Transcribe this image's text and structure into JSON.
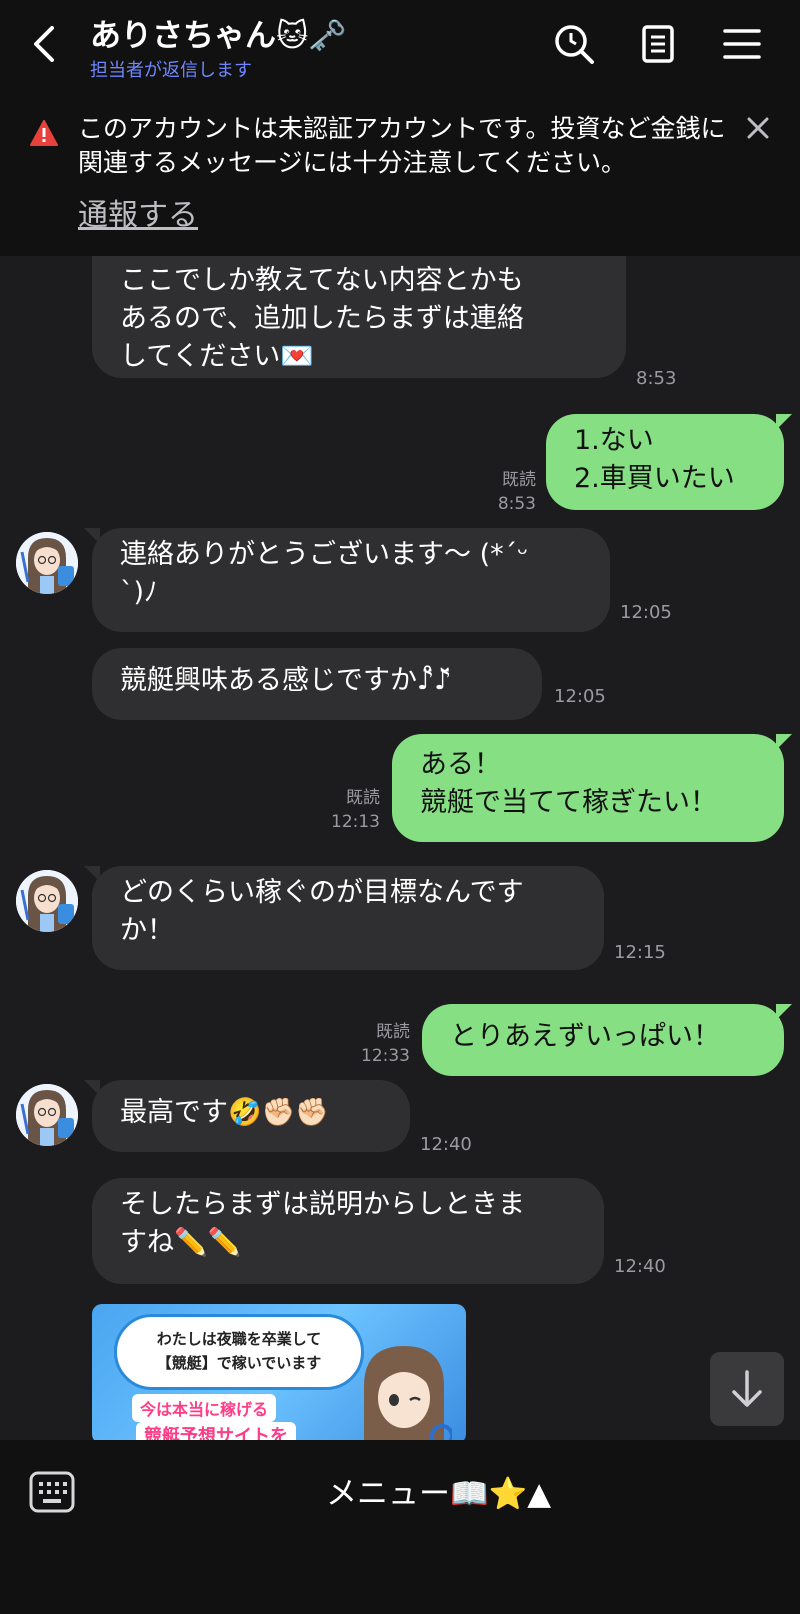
{
  "header": {
    "title": "ありさちゃん🐱🗝️",
    "subtitle": "担当者が返信します"
  },
  "warning": {
    "text": "このアカウントは未認証アカウントです。投資など金銭に関連するメッセージには十分注意してください。",
    "link": "通報する"
  },
  "messages": [
    {
      "side": "in",
      "lines": [
        "ここでしか教えてない内容とかも",
        "あるので、追加したらまずは連絡",
        "してください💌"
      ],
      "time": "8:53"
    },
    {
      "side": "out",
      "lines": [
        "1.ない",
        "2.車買いたい"
      ],
      "read": "既読",
      "time": "8:53"
    },
    {
      "side": "in",
      "lines": [
        "連絡ありがとうございます〜 (*´ᵕ",
        "`)ﾉ"
      ],
      "time": "12:05"
    },
    {
      "side": "in",
      "lines": [
        "競艇興味ある感じですか♪̊̈♪̆̈"
      ],
      "time": "12:05"
    },
    {
      "side": "out",
      "lines": [
        "ある！",
        "競艇で当てて稼ぎたい！"
      ],
      "read": "既読",
      "time": "12:13"
    },
    {
      "side": "in",
      "lines": [
        "どのくらい稼ぐのが目標なんです",
        "か！"
      ],
      "time": "12:15"
    },
    {
      "side": "out",
      "lines": [
        "とりあえずいっぱい！"
      ],
      "read": "既読",
      "time": "12:33"
    },
    {
      "side": "in",
      "lines": [
        "最高です🤣✊🏻✊🏻"
      ],
      "time": "12:40"
    },
    {
      "side": "in",
      "lines": [
        "そしたらまずは説明からしときま",
        "すね✏️✏️"
      ],
      "time": "12:40"
    }
  ],
  "image_card": {
    "line1": "わたしは夜職を卒業して",
    "line2": "【競艇】で稼いでいます",
    "band1": "今は本当に稼げる",
    "band2": "競艇予想サイトを"
  },
  "footer": {
    "menu_label": "メニュー📖⭐▲"
  },
  "icons": [
    "back-icon",
    "search-icon",
    "note-icon",
    "menu-icon",
    "warning-icon",
    "close-icon",
    "scroll-down-icon",
    "keyboard-icon"
  ],
  "colors": {
    "outgoing": "#86df82",
    "incoming": "#2f2f31",
    "background": "#1c1c1e",
    "accent": "#6f86ff",
    "warning": "#e8413d"
  }
}
